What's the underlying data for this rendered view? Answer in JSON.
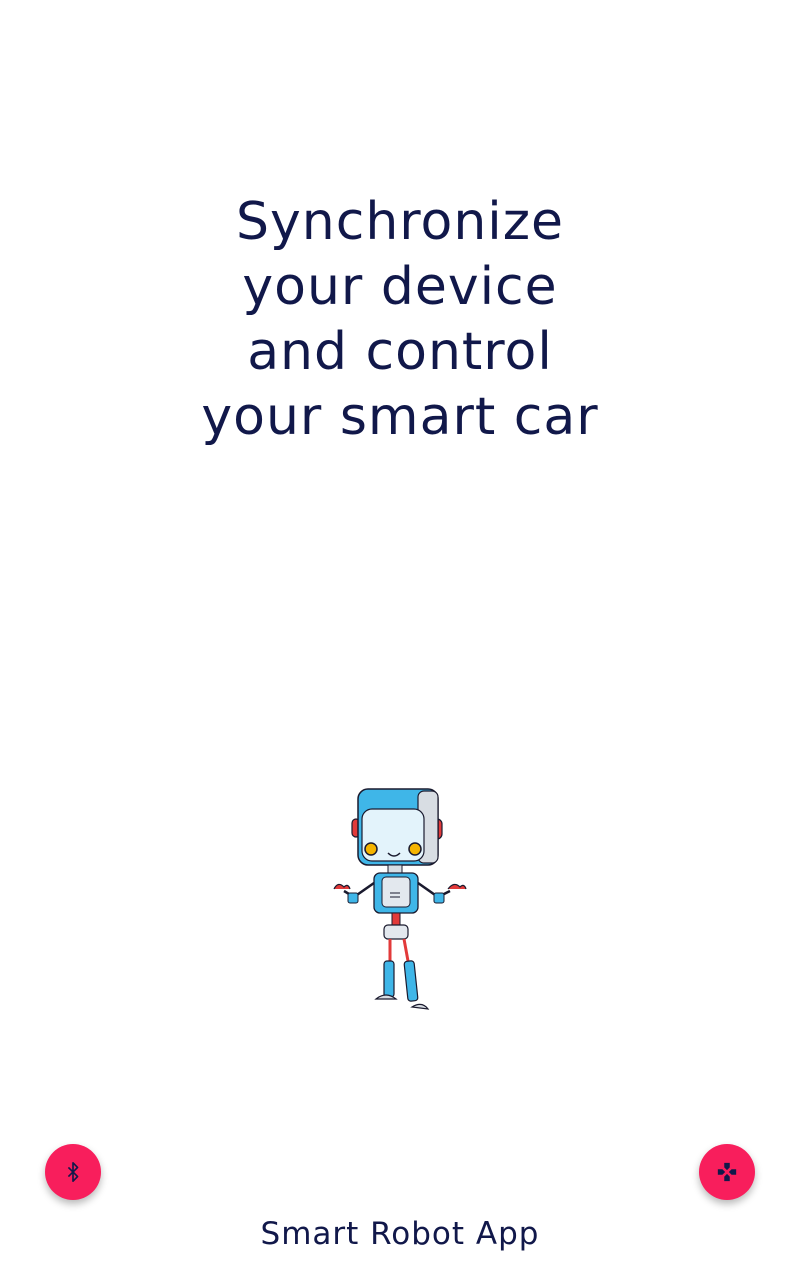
{
  "headline": {
    "lines": [
      "Synchronize",
      "your device",
      "and control",
      "your smart car"
    ]
  },
  "illustration": {
    "icon": "robot-icon"
  },
  "actions": {
    "bluetooth": {
      "icon": "bluetooth-icon"
    },
    "control": {
      "icon": "gamepad-icon"
    }
  },
  "footer": {
    "app_name": "Smart Robot App"
  },
  "colors": {
    "text": "#11184a",
    "accent": "#f81e5c",
    "robot_blue": "#3fb6e8",
    "robot_red": "#e23a3a",
    "background": "#ffffff"
  }
}
